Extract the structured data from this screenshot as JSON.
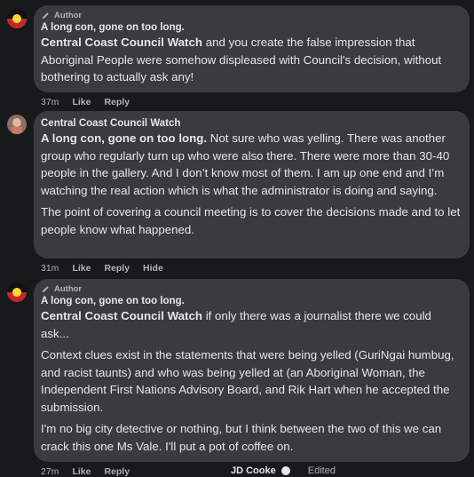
{
  "comments": [
    {
      "avatar": "flag-avatar",
      "badge": "Author",
      "name": "A long con, gone on too long.",
      "mention": "Central Coast Council Watch",
      "text_after_mention": " and you create the false impression that Aboriginal People were somehow displeased with Council's decision, without bothering to actually ask any!",
      "time": "37m",
      "actions": [
        "Like",
        "Reply"
      ]
    },
    {
      "avatar": "photo-avatar",
      "name": "Central Coast Council Watch",
      "mention": "A long con, gone on too long.",
      "text_after_mention": " Not sure who was yelling. There was another group who regularly turn up who were also there. There were more than 30-40 people in the gallery. And I don’t know most of them. I am up one end and I’m watching the real action which is what the administrator is doing and saying.",
      "para2": "The point of covering a council meeting is to cover the decisions made and to let people know what happened.",
      "time": "31m",
      "actions": [
        "Like",
        "Reply",
        "Hide"
      ]
    },
    {
      "avatar": "flag-avatar",
      "badge": "Author",
      "name": "A long con, gone on too long.",
      "mention": "Central Coast Council Watch",
      "text_after_mention": " if only there was a journalist there we could ask...",
      "para2": "Context clues exist in the statements that were being yelled (GuriNgai humbug, and racist taunts) and who was being yelled at (an Aboriginal Woman, the Independent First Nations Advisory Board, and Rik Hart when he accepted the submission.",
      "para3": "I'm no big city detective or nothing, but I think between the two of this we can crack this one Ms Vale. I'll put a pot of coffee on.",
      "time": "27m",
      "actions": [
        "Like",
        "Reply"
      ]
    }
  ],
  "reply_indicator": {
    "name": "JD Cooke",
    "status": "Edited"
  },
  "colors": {
    "background": "#18191a",
    "bubble": "#3a3b3c",
    "text": "#e4e6eb",
    "muted": "#b0b3b8"
  }
}
